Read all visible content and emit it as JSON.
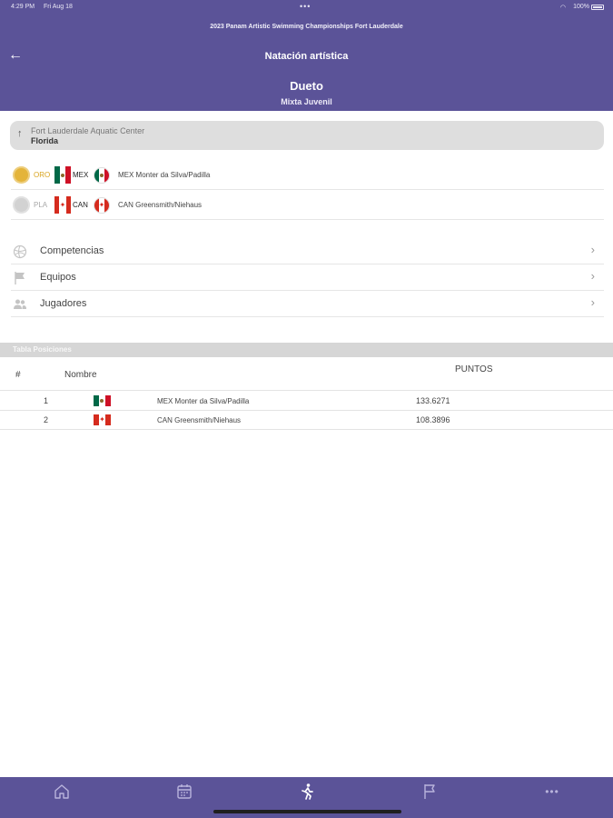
{
  "status_bar": {
    "time": "4:29 PM",
    "date": "Fri Aug 18",
    "battery": "100%"
  },
  "header": {
    "event_title": "2023 Panam Artistic Swimming Championships Fort Lauderdale",
    "sport": "Natación artística",
    "event_name": "Dueto",
    "category": "Mixta Juvenil",
    "color": "#5b5398"
  },
  "venue": {
    "name": "Fort Lauderdale Aquatic Center",
    "city": "Florida"
  },
  "medals": [
    {
      "medal": "ORO",
      "country": "MEX",
      "team": "MEX Monter da Silva/Padilla",
      "medal_color": "#e4b43a",
      "label_color": "#d9a520"
    },
    {
      "medal": "PLA",
      "country": "CAN",
      "team": "CAN Greensmith/Niehaus",
      "medal_color": "#d2d2d2",
      "label_color": "#a8a8a8"
    }
  ],
  "nav": [
    {
      "label": "Competencias",
      "icon": "ball-icon"
    },
    {
      "label": "Equipos",
      "icon": "flag-icon"
    },
    {
      "label": "Jugadores",
      "icon": "users-icon"
    }
  ],
  "standings": {
    "section_title": "Tabla Posiciones",
    "headers": {
      "num": "#",
      "name": "Nombre",
      "points": "PUNTOS"
    },
    "rows": [
      {
        "pos": "1",
        "country": "MEX",
        "team": "MEX Monter da Silva/Padilla",
        "score": "133.6271"
      },
      {
        "pos": "2",
        "country": "CAN",
        "team": "CAN Greensmith/Niehaus",
        "score": "108.3896"
      }
    ]
  },
  "tabs": [
    {
      "name": "home-icon"
    },
    {
      "name": "calendar-icon"
    },
    {
      "name": "athlete-icon"
    },
    {
      "name": "flag-icon"
    },
    {
      "name": "more-icon"
    }
  ],
  "tab_more_label": "•••"
}
